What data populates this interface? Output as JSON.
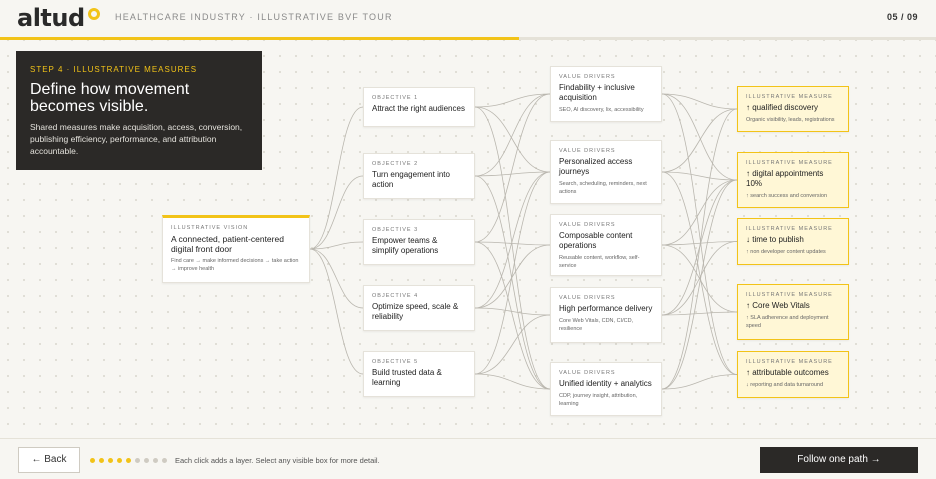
{
  "header": {
    "logo": "altud",
    "breadcrumb": "HEALTHCARE INDUSTRY · ILLUSTRATIVE BVF TOUR",
    "counter": "05 / 09",
    "progress": 0.555,
    "accent_color": "#f2c318"
  },
  "step": {
    "label": "STEP 4 · ILLUSTRATIVE MEASURES",
    "title": "Define how movement becomes visible.",
    "description": "Shared measures make acquisition, access, conversion, publishing efficiency, performance, and attribution accountable."
  },
  "vision": {
    "label": "ILLUSTRATIVE VISION",
    "title": "A connected, patient-centered digital front door",
    "detail": "Find care → make informed decisions → take action → improve health"
  },
  "objectives": [
    {
      "label": "OBJECTIVE 1",
      "title": "Attract the right audiences"
    },
    {
      "label": "OBJECTIVE 2",
      "title": "Turn engagement into action"
    },
    {
      "label": "OBJECTIVE 3",
      "title": "Empower teams & simplify operations"
    },
    {
      "label": "OBJECTIVE 4",
      "title": "Optimize speed, scale & reliability"
    },
    {
      "label": "OBJECTIVE 5",
      "title": "Build trusted data & learning"
    }
  ],
  "drivers": [
    {
      "label": "VALUE DRIVERS",
      "title": "Findability + inclusive acquisition",
      "detail": "SEO, AI discovery, lix, accessibility"
    },
    {
      "label": "VALUE DRIVERS",
      "title": "Personalized access journeys",
      "detail": "Search, scheduling, reminders, next actions"
    },
    {
      "label": "VALUE DRIVERS",
      "title": "Composable content operations",
      "detail": "Reusable content, workflow, self-service"
    },
    {
      "label": "VALUE DRIVERS",
      "title": "High performance delivery",
      "detail": "Core Web Vitals, CDN, CI/CD, resilience"
    },
    {
      "label": "VALUE DRIVERS",
      "title": "Unified identity + analytics",
      "detail": "CDP, journey insight, attribution, learning"
    }
  ],
  "measures": [
    {
      "label": "ILLUSTRATIVE MEASURE",
      "title": "↑ qualified discovery",
      "detail": "Organic visibility, leads, registrations"
    },
    {
      "label": "ILLUSTRATIVE MEASURE",
      "title": "↑ digital appointments 10%",
      "detail": "↑ search success and conversion"
    },
    {
      "label": "ILLUSTRATIVE MEASURE",
      "title": "↓ time to publish",
      "detail": "↑ non developer content updates"
    },
    {
      "label": "ILLUSTRATIVE MEASURE",
      "title": "↑ Core Web Vitals",
      "detail": "↑ SLA adherence and deployment speed"
    },
    {
      "label": "ILLUSTRATIVE MEASURE",
      "title": "↑ attributable outcomes",
      "detail": "↓ reporting and data turnaround"
    }
  ],
  "footer": {
    "back_label": "← Back",
    "hint": "Each click adds a layer. Select any visible box for more detail.",
    "follow_label": "Follow one path →",
    "steps_total": 9,
    "steps_done": 5,
    "dot_active_color": "#f2c318",
    "dot_inactive_color": "#cfcbc2"
  }
}
